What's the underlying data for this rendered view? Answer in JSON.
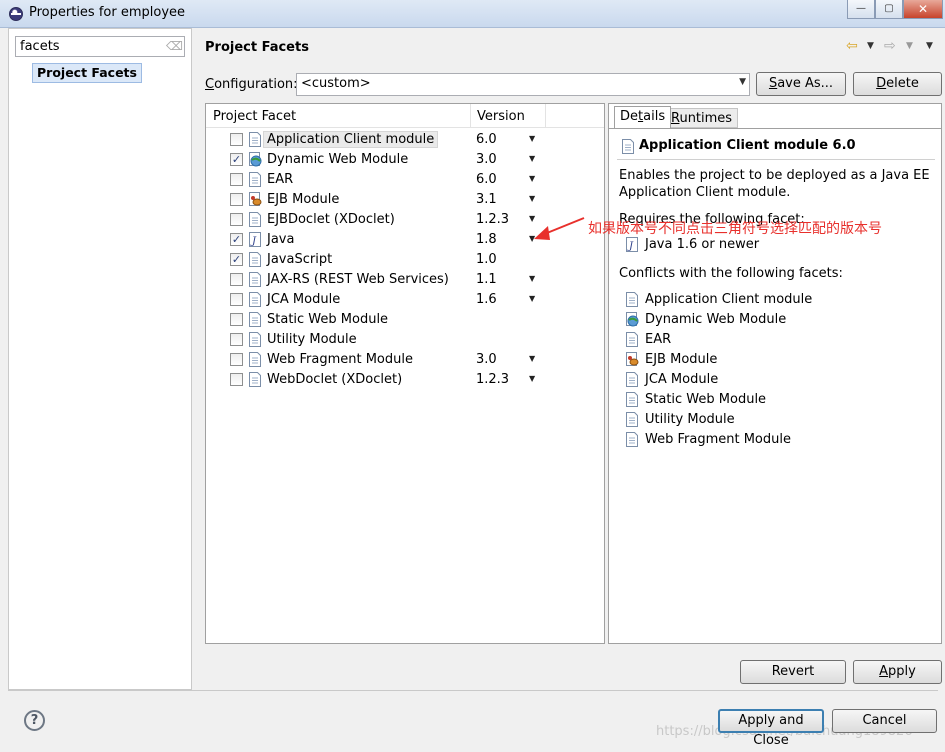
{
  "window": {
    "title": "Properties for employee"
  },
  "left_pane": {
    "filter_value": "facets",
    "tree_items": [
      {
        "label": "Project Facets"
      }
    ]
  },
  "header": {
    "title": "Project Facets"
  },
  "configuration": {
    "label_accel": "C",
    "label_rest": "onfiguration:",
    "value": "<custom>",
    "save_as_accel": "S",
    "save_as_rest": "ave As...",
    "delete_accel": "D",
    "delete_rest": "elete"
  },
  "facets_table": {
    "columns": [
      "Project Facet",
      "Version"
    ],
    "rows": [
      {
        "name": "Application Client module",
        "version": "6.0",
        "checked": false,
        "icon": "page-icon",
        "dropdown": true
      },
      {
        "name": "Dynamic Web Module",
        "version": "3.0",
        "checked": true,
        "icon": "web-globe-icon",
        "dropdown": true
      },
      {
        "name": "EAR",
        "version": "6.0",
        "checked": false,
        "icon": "page-icon",
        "dropdown": true
      },
      {
        "name": "EJB Module",
        "version": "3.1",
        "checked": false,
        "icon": "ejb-bean-icon",
        "dropdown": true
      },
      {
        "name": "EJBDoclet (XDoclet)",
        "version": "1.2.3",
        "checked": false,
        "icon": "page-icon",
        "dropdown": true
      },
      {
        "name": "Java",
        "version": "1.8",
        "checked": true,
        "icon": "java-j-icon",
        "dropdown": true
      },
      {
        "name": "JavaScript",
        "version": "1.0",
        "checked": true,
        "icon": "page-icon",
        "dropdown": false
      },
      {
        "name": "JAX-RS (REST Web Services)",
        "version": "1.1",
        "checked": false,
        "icon": "page-icon",
        "dropdown": true
      },
      {
        "name": "JCA Module",
        "version": "1.6",
        "checked": false,
        "icon": "page-icon",
        "dropdown": true
      },
      {
        "name": "Static Web Module",
        "version": "",
        "checked": false,
        "icon": "page-icon",
        "dropdown": false
      },
      {
        "name": "Utility Module",
        "version": "",
        "checked": false,
        "icon": "page-icon",
        "dropdown": false
      },
      {
        "name": "Web Fragment Module",
        "version": "3.0",
        "checked": false,
        "icon": "page-icon",
        "dropdown": true
      },
      {
        "name": "WebDoclet (XDoclet)",
        "version": "1.2.3",
        "checked": false,
        "icon": "page-icon",
        "dropdown": true
      }
    ]
  },
  "details": {
    "tabs": [
      {
        "label_pre": "De",
        "label_accel": "t",
        "label_post": "ails"
      },
      {
        "label_pre": "",
        "label_accel": "R",
        "label_post": "untimes"
      }
    ],
    "title": "Application Client module 6.0",
    "description_line1": "Enables the project to be deployed as a Java EE",
    "description_line2": "Application Client module.",
    "requires_heading": "Requires the following facet:",
    "requires": [
      {
        "name": "Java 1.6 or newer",
        "icon": "java-j-icon"
      }
    ],
    "conflicts_heading": "Conflicts with the following facets:",
    "conflicts": [
      {
        "name": "Application Client module",
        "icon": "page-icon"
      },
      {
        "name": "Dynamic Web Module",
        "icon": "web-globe-icon"
      },
      {
        "name": "EAR",
        "icon": "page-icon"
      },
      {
        "name": "EJB Module",
        "icon": "ejb-bean-icon"
      },
      {
        "name": "JCA Module",
        "icon": "page-icon"
      },
      {
        "name": "Static Web Module",
        "icon": "page-icon"
      },
      {
        "name": "Utility Module",
        "icon": "page-icon"
      },
      {
        "name": "Web Fragment Module",
        "icon": "page-icon"
      }
    ]
  },
  "annotation": {
    "text": "如果版本号不同点击三角符号选择匹配的版本号",
    "color": "#e8302c"
  },
  "buttons": {
    "revert": "Revert",
    "apply_accel": "A",
    "apply_rest": "pply",
    "apply_close": "Apply and Close",
    "cancel": "Cancel"
  },
  "help_glyph": "?",
  "watermark": "https://blog.csdn.net/baichuang189826"
}
